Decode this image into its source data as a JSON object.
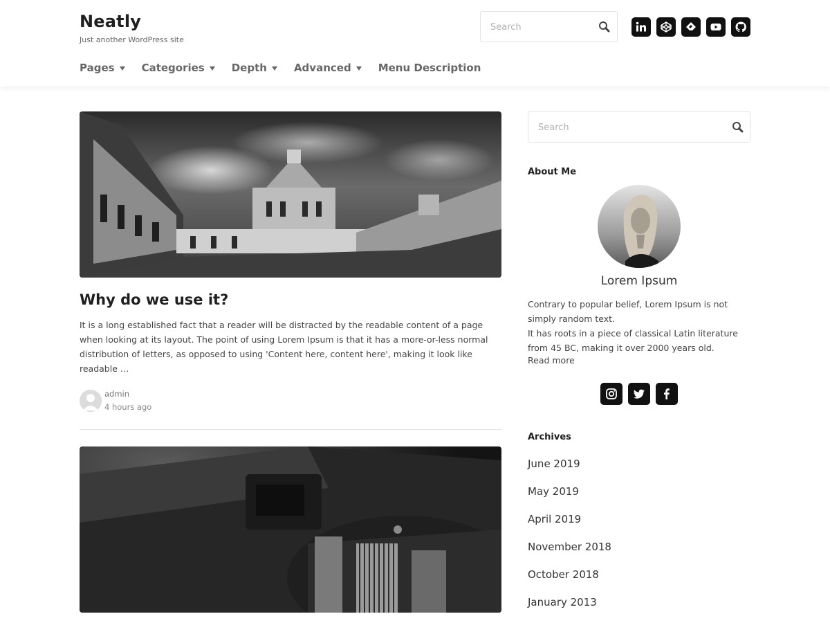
{
  "header": {
    "site_title": "Neatly",
    "tagline": "Just another WordPress site",
    "search_placeholder": "Search",
    "social_icons": [
      "linkedin-icon",
      "codepen-icon",
      "feedly-icon",
      "youtube-icon",
      "github-icon"
    ]
  },
  "nav": {
    "items": [
      {
        "label": "Pages",
        "has_dropdown": true
      },
      {
        "label": "Categories",
        "has_dropdown": true
      },
      {
        "label": "Depth",
        "has_dropdown": true
      },
      {
        "label": "Advanced",
        "has_dropdown": true
      },
      {
        "label": "Menu Description",
        "has_dropdown": false
      }
    ]
  },
  "posts": [
    {
      "title": "Why do we use it?",
      "excerpt": "It is a long established fact that a reader will be distracted by the readable content of a page when looking at its layout. The point of using Lorem Ipsum is that it has a more-or-less normal distribution of letters, as opposed to using 'Content here, content here', making it look like readable …",
      "author": "admin",
      "time": "4 hours ago"
    }
  ],
  "sidebar": {
    "search_placeholder": "Search",
    "about": {
      "title": "About Me",
      "name": "Lorem Ipsum",
      "line1": "Contrary to popular belief, Lorem Ipsum is not simply random text.",
      "line2": "It has roots in a piece of classical Latin literature from 45 BC, making it over 2000 years old.",
      "read_more": "Read more",
      "social_icons": [
        "instagram-icon",
        "twitter-icon",
        "facebook-icon"
      ]
    },
    "archives": {
      "title": "Archives",
      "items": [
        "June 2019",
        "May 2019",
        "April 2019",
        "November 2018",
        "October 2018",
        "January 2013"
      ]
    }
  },
  "colors": {
    "text_dark": "#1f1f1f",
    "nav_text": "#666666",
    "icon_bg": "#111111"
  }
}
